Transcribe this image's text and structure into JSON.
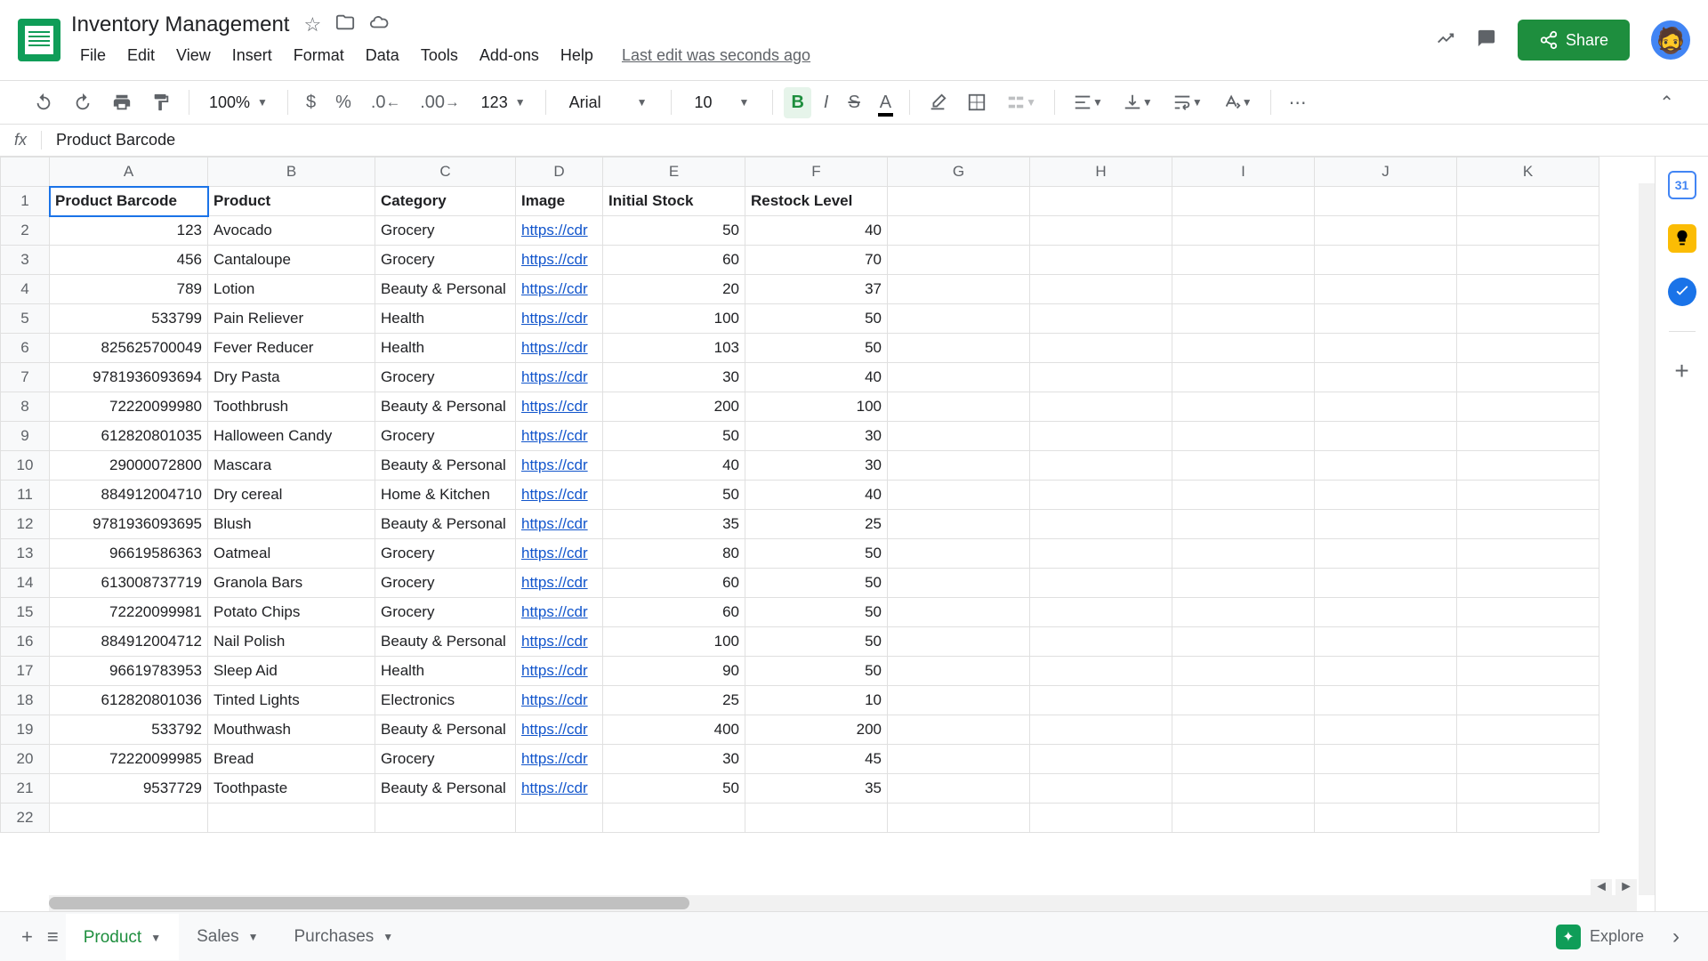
{
  "doc": {
    "title": "Inventory Management",
    "last_edit": "Last edit was seconds ago"
  },
  "menu": {
    "file": "File",
    "edit": "Edit",
    "view": "View",
    "insert": "Insert",
    "format": "Format",
    "data": "Data",
    "tools": "Tools",
    "addons": "Add-ons",
    "help": "Help"
  },
  "share": {
    "label": "Share"
  },
  "toolbar": {
    "zoom": "100%",
    "font": "Arial",
    "size": "10",
    "format_num": "123"
  },
  "formula": {
    "fx": "fx",
    "value": "Product Barcode"
  },
  "columns": [
    "A",
    "B",
    "C",
    "D",
    "E",
    "F",
    "G",
    "H",
    "I",
    "J",
    "K"
  ],
  "headers": {
    "barcode": "Product Barcode",
    "product": "Product",
    "category": "Category",
    "image": "Image",
    "initial_stock": "Initial Stock",
    "restock": "Restock Level"
  },
  "link_text": "https://cdr",
  "rows": [
    {
      "barcode": "123",
      "product": "Avocado",
      "category": "Grocery",
      "stock": "50",
      "restock": "40"
    },
    {
      "barcode": "456",
      "product": "Cantaloupe",
      "category": "Grocery",
      "stock": "60",
      "restock": "70"
    },
    {
      "barcode": "789",
      "product": "Lotion",
      "category": "Beauty & Personal",
      "stock": "20",
      "restock": "37"
    },
    {
      "barcode": "533799",
      "product": "Pain Reliever",
      "category": "Health",
      "stock": "100",
      "restock": "50"
    },
    {
      "barcode": "825625700049",
      "product": "Fever Reducer",
      "category": "Health",
      "stock": "103",
      "restock": "50"
    },
    {
      "barcode": "9781936093694",
      "product": "Dry Pasta",
      "category": "Grocery",
      "stock": "30",
      "restock": "40"
    },
    {
      "barcode": "72220099980",
      "product": "Toothbrush",
      "category": "Beauty & Personal",
      "stock": "200",
      "restock": "100"
    },
    {
      "barcode": "612820801035",
      "product": "Halloween Candy",
      "category": "Grocery",
      "stock": "50",
      "restock": "30"
    },
    {
      "barcode": "29000072800",
      "product": "Mascara",
      "category": "Beauty & Personal",
      "stock": "40",
      "restock": "30"
    },
    {
      "barcode": "884912004710",
      "product": "Dry cereal",
      "category": "Home & Kitchen",
      "stock": "50",
      "restock": "40"
    },
    {
      "barcode": "9781936093695",
      "product": "Blush",
      "category": "Beauty & Personal",
      "stock": "35",
      "restock": "25"
    },
    {
      "barcode": "96619586363",
      "product": "Oatmeal",
      "category": "Grocery",
      "stock": "80",
      "restock": "50"
    },
    {
      "barcode": "613008737719",
      "product": "Granola Bars",
      "category": "Grocery",
      "stock": "60",
      "restock": "50"
    },
    {
      "barcode": "72220099981",
      "product": "Potato Chips",
      "category": "Grocery",
      "stock": "60",
      "restock": "50"
    },
    {
      "barcode": "884912004712",
      "product": "Nail Polish",
      "category": "Beauty & Personal",
      "stock": "100",
      "restock": "50"
    },
    {
      "barcode": "96619783953",
      "product": "Sleep Aid",
      "category": "Health",
      "stock": "90",
      "restock": "50"
    },
    {
      "barcode": "612820801036",
      "product": "Tinted Lights",
      "category": "Electronics",
      "stock": "25",
      "restock": "10"
    },
    {
      "barcode": "533792",
      "product": "Mouthwash",
      "category": "Beauty & Personal",
      "stock": "400",
      "restock": "200"
    },
    {
      "barcode": "72220099985",
      "product": "Bread",
      "category": "Grocery",
      "stock": "30",
      "restock": "45"
    },
    {
      "barcode": "9537729",
      "product": "Toothpaste",
      "category": "Beauty & Personal",
      "stock": "50",
      "restock": "35"
    }
  ],
  "tabs": {
    "product": "Product",
    "sales": "Sales",
    "purchases": "Purchases"
  },
  "explore": "Explore",
  "sidecal": "31"
}
